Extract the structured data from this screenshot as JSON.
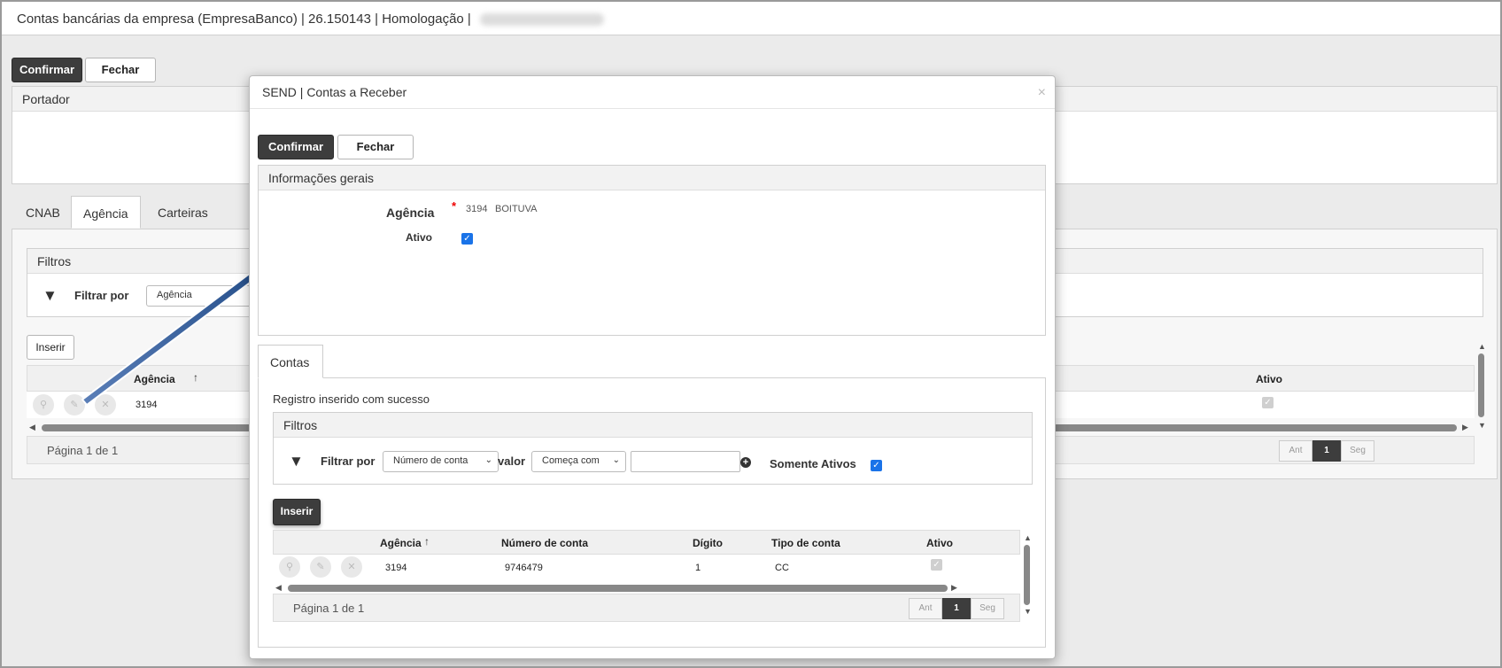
{
  "window": {
    "title": "Contas bancárias da empresa (EmpresaBanco) | 26.150143 | Homologação |"
  },
  "background": {
    "confirm_label": "Confirmar",
    "close_label": "Fechar",
    "portador_title": "Portador",
    "tabs": [
      "CNAB",
      "Agência",
      "Carteiras"
    ],
    "filters_title": "Filtros",
    "filter_by_label": "Filtrar por",
    "filter_by_value": "Agência",
    "insert_label": "Inserir",
    "table": {
      "columns": [
        "Agência",
        "Ativo"
      ],
      "row": {
        "agencia": "3194",
        "ativo": true
      }
    },
    "page_text": "Página 1 de 1",
    "pager": {
      "prev": "Ant",
      "current": "1",
      "next": "Seg"
    }
  },
  "modal": {
    "title": "SEND | Contas a Receber",
    "close_glyph": "×",
    "confirm_label": "Confirmar",
    "close_label": "Fechar",
    "general_info_title": "Informações gerais",
    "agencia_label": "Agência",
    "required_mark": "*",
    "agencia_code": "3194",
    "agencia_name": "BOITUVA",
    "ativo_label": "Ativo",
    "ativo_checked": true,
    "tab_label": "Contas",
    "success_message": "Registro inserido com sucesso",
    "filters_title": "Filtros",
    "filter_by_label": "Filtrar por",
    "filter_field": "Número de conta",
    "valor_label": "valor",
    "filter_operator": "Começa com",
    "filter_value": "",
    "somente_ativos_label": "Somente Ativos",
    "somente_ativos_checked": true,
    "insert_label": "Inserir",
    "table": {
      "columns": [
        "Agência",
        "Número de conta",
        "Dígito",
        "Tipo de conta",
        "Ativo"
      ],
      "rows": [
        {
          "agencia": "3194",
          "numero": "9746479",
          "digito": "1",
          "tipo": "CC",
          "ativo": true
        }
      ]
    },
    "page_text": "Página 1 de 1",
    "pager": {
      "prev": "Ant",
      "current": "1",
      "next": "Seg"
    }
  },
  "colors": {
    "dark_button": "#3d3d3d",
    "arrow": "#1f4e8c",
    "checkbox": "#1a73e8"
  },
  "icons": [
    "search-icon",
    "edit-icon",
    "delete-icon",
    "filter-icon",
    "add-circle-icon",
    "sort-up-icon",
    "close-icon"
  ]
}
